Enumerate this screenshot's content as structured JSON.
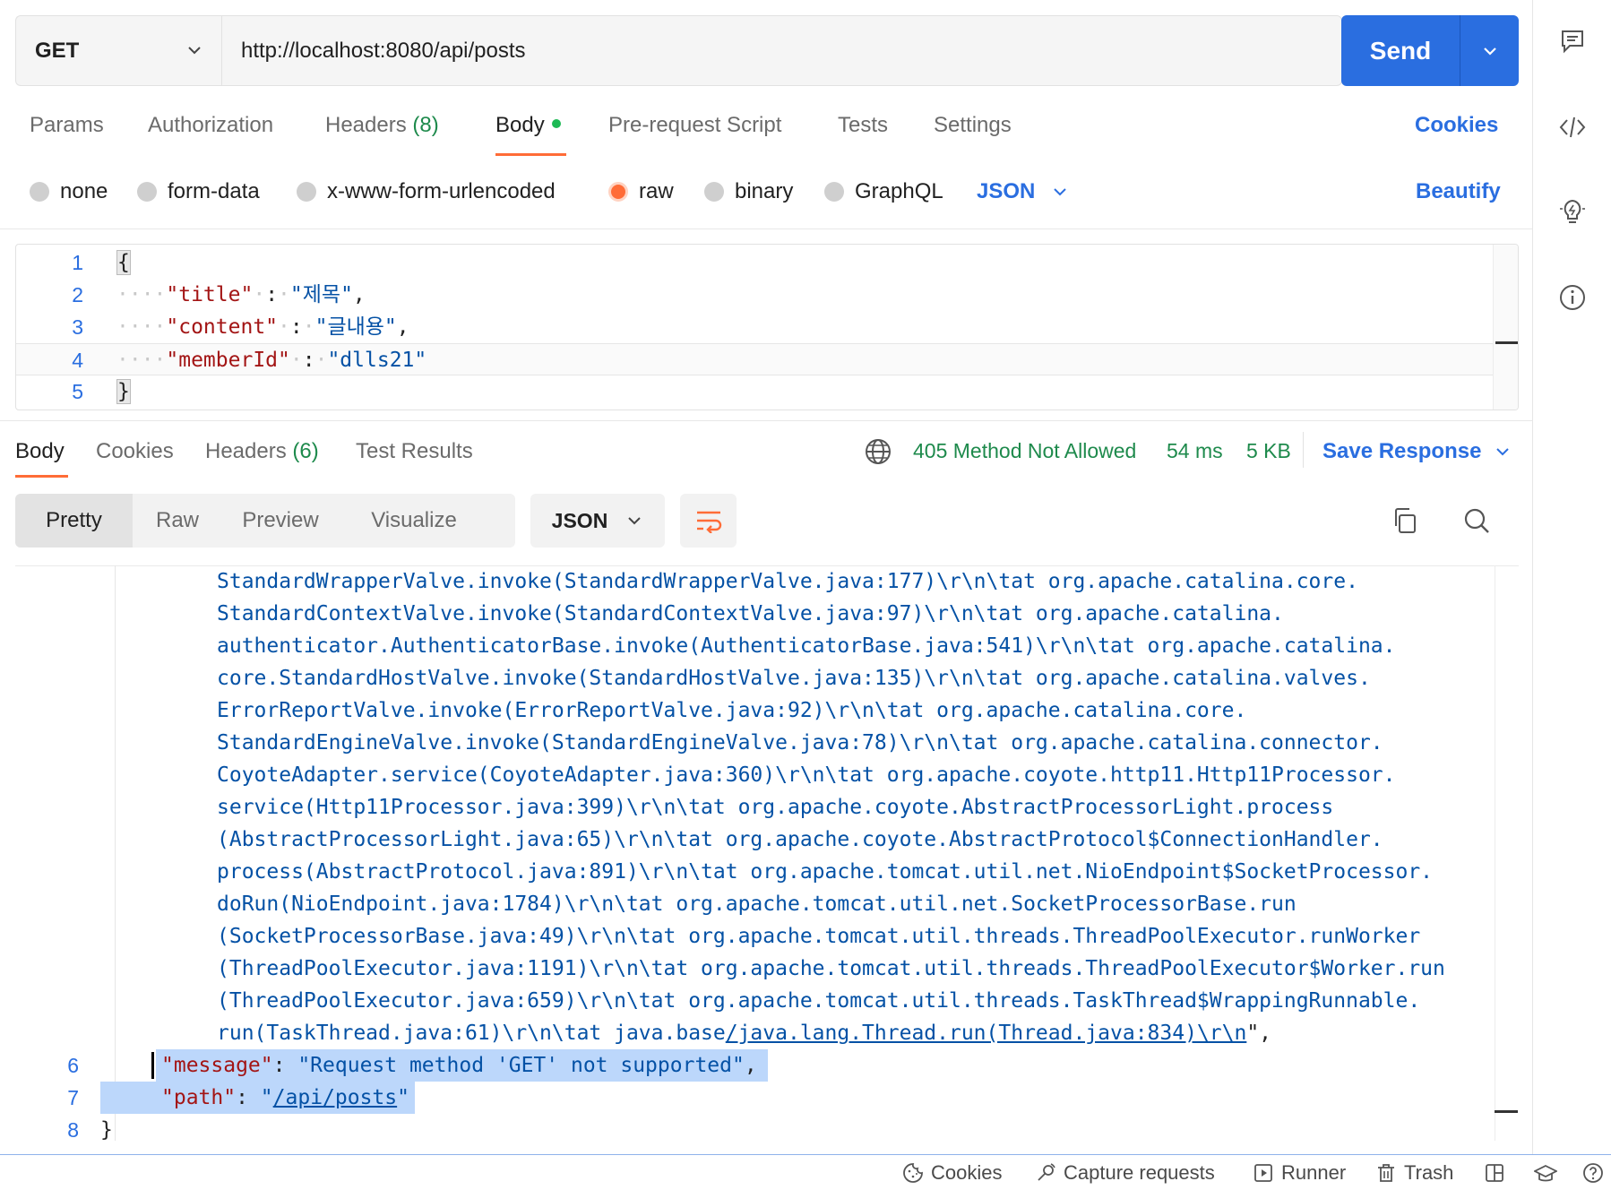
{
  "request": {
    "method": "GET",
    "url": "http://localhost:8080/api/posts",
    "send_label": "Send"
  },
  "request_tabs": {
    "params": "Params",
    "authorization": "Authorization",
    "headers": "Headers",
    "headers_count": "(8)",
    "body": "Body",
    "prerequest": "Pre-request Script",
    "tests": "Tests",
    "settings": "Settings",
    "cookies": "Cookies"
  },
  "body_types": {
    "none": "none",
    "form_data": "form-data",
    "urlencoded": "x-www-form-urlencoded",
    "raw": "raw",
    "binary": "binary",
    "graphql": "GraphQL",
    "language": "JSON",
    "beautify": "Beautify",
    "selected": "raw"
  },
  "request_body": {
    "line_numbers": [
      "1",
      "2",
      "3",
      "4",
      "5"
    ],
    "open_brace": "{",
    "close_brace": "}",
    "fields": [
      {
        "key": "\"title\"",
        "value": "\"제목\"",
        "trail": ","
      },
      {
        "key": "\"content\"",
        "value": "\"글내용\"",
        "trail": ","
      },
      {
        "key": "\"memberId\"",
        "value": "\"dlls21\"",
        "trail": ""
      }
    ]
  },
  "response_tabs": {
    "body": "Body",
    "cookies": "Cookies",
    "headers": "Headers",
    "headers_count": "(6)",
    "test_results": "Test Results"
  },
  "response_status": {
    "status": "405 Method Not Allowed",
    "time": "54 ms",
    "size": "5 KB",
    "save_response": "Save Response"
  },
  "response_views": {
    "pretty": "Pretty",
    "raw": "Raw",
    "preview": "Preview",
    "visualize": "Visualize",
    "format": "JSON"
  },
  "response_body": {
    "trace_lines": [
      "StandardWrapperValve.invoke(StandardWrapperValve.java:177)\\r\\n\\tat org.apache.catalina.core.",
      "StandardContextValve.invoke(StandardContextValve.java:97)\\r\\n\\tat org.apache.catalina.",
      "authenticator.AuthenticatorBase.invoke(AuthenticatorBase.java:541)\\r\\n\\tat org.apache.catalina.",
      "core.StandardHostValve.invoke(StandardHostValve.java:135)\\r\\n\\tat org.apache.catalina.valves.",
      "ErrorReportValve.invoke(ErrorReportValve.java:92)\\r\\n\\tat org.apache.catalina.core.",
      "StandardEngineValve.invoke(StandardEngineValve.java:78)\\r\\n\\tat org.apache.catalina.connector.",
      "CoyoteAdapter.service(CoyoteAdapter.java:360)\\r\\n\\tat org.apache.coyote.http11.Http11Processor.",
      "service(Http11Processor.java:399)\\r\\n\\tat org.apache.coyote.AbstractProcessorLight.process",
      "(AbstractProcessorLight.java:65)\\r\\n\\tat org.apache.coyote.AbstractProtocol$ConnectionHandler.",
      "process(AbstractProtocol.java:891)\\r\\n\\tat org.apache.tomcat.util.net.NioEndpoint$SocketProcessor.",
      "doRun(NioEndpoint.java:1784)\\r\\n\\tat org.apache.tomcat.util.net.SocketProcessorBase.run",
      "(SocketProcessorBase.java:49)\\r\\n\\tat org.apache.tomcat.util.threads.ThreadPoolExecutor.runWorker",
      "(ThreadPoolExecutor.java:1191)\\r\\n\\tat org.apache.tomcat.util.threads.ThreadPoolExecutor$Worker.run",
      "(ThreadPoolExecutor.java:659)\\r\\n\\tat org.apache.tomcat.util.threads.TaskThread$WrappingRunnable."
    ],
    "last_trace_prefix": "run(TaskThread.java:61)\\r\\n\\tat java.base",
    "last_trace_link": "/java.lang.Thread.run(Thread.java:834)\\r\\n",
    "last_trace_suffix": "\",",
    "line_numbers": [
      "6",
      "7",
      "8"
    ],
    "message_key": "\"message\"",
    "message_value": "\"Request method 'GET' not supported\"",
    "path_key": "\"path\"",
    "path_value_link": "/api/posts",
    "close_brace": "}"
  },
  "footer": {
    "cookies": "Cookies",
    "capture": "Capture requests",
    "runner": "Runner",
    "trash": "Trash"
  },
  "colors": {
    "accent": "#ff6c37",
    "primary": "#2a6ee0",
    "success": "#1e8a4c",
    "selection": "#bcd7fb"
  },
  "icons": {
    "rail": [
      "comments-icon",
      "code-icon",
      "lightbulb-icon",
      "info-icon"
    ],
    "toolbar": [
      "wrap-icon",
      "copy-icon",
      "search-icon"
    ],
    "footer": [
      "cookie-icon",
      "capture-icon",
      "runner-icon",
      "trash-icon",
      "layout-icon",
      "bootcamp-icon",
      "help-icon"
    ]
  }
}
